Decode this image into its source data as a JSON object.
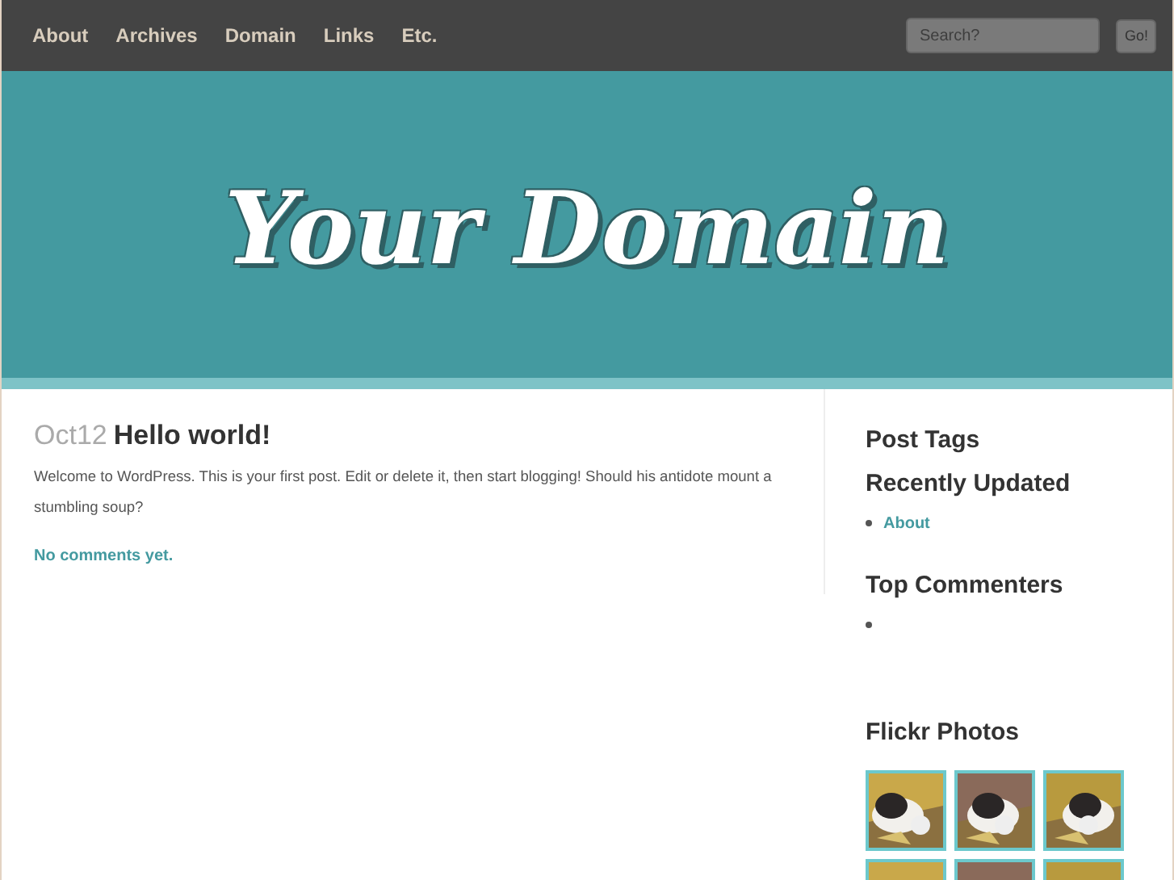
{
  "nav": {
    "items": [
      "About",
      "Archives",
      "Domain",
      "Links",
      "Etc."
    ]
  },
  "search": {
    "placeholder": "Search?",
    "button": "Go!"
  },
  "header": {
    "logo": "Your Domain"
  },
  "post": {
    "date": "Oct12",
    "title": "Hello world!",
    "body": "Welcome to WordPress. This is your first post. Edit or delete it, then start blogging! Should his antidote mount a stumbling soup?",
    "comments": "No comments yet."
  },
  "sidebar": [
    {
      "kind": "heading",
      "title": "Post Tags"
    },
    {
      "kind": "list",
      "title": "Recently Updated",
      "items": [
        {
          "kind": "link",
          "text": "About"
        }
      ]
    },
    {
      "kind": "list",
      "title": "Top Commenters",
      "items": [
        {
          "kind": "empty"
        }
      ]
    },
    {
      "kind": "photos",
      "title": "Flickr Photos"
    }
  ]
}
